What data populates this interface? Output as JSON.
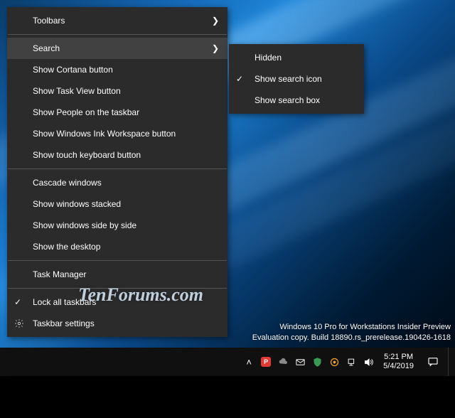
{
  "menu": {
    "toolbars": "Toolbars",
    "search": "Search",
    "show_cortana": "Show Cortana button",
    "show_taskview": "Show Task View button",
    "show_people": "Show People on the taskbar",
    "show_ink": "Show Windows Ink Workspace button",
    "show_touchkb": "Show touch keyboard button",
    "cascade": "Cascade windows",
    "stacked": "Show windows stacked",
    "sidebyside": "Show windows side by side",
    "show_desktop": "Show the desktop",
    "task_manager": "Task Manager",
    "lock_taskbars": "Lock all taskbars",
    "taskbar_settings": "Taskbar settings"
  },
  "submenu": {
    "hidden": "Hidden",
    "show_icon": "Show search icon",
    "show_box": "Show search box"
  },
  "watermark": {
    "line1": "Windows 10 Pro for Workstations Insider Preview",
    "line2": "Evaluation copy. Build 18890.rs_prerelease.190426-1618"
  },
  "clock": {
    "time": "5:21 PM",
    "date": "5/4/2019"
  },
  "overlay": "TenForums.com"
}
